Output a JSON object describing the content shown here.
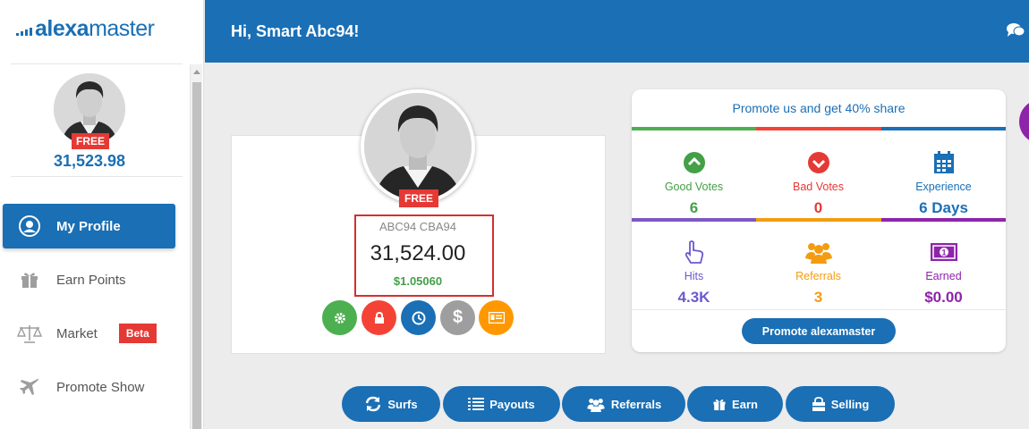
{
  "brand": {
    "part1": "alexa",
    "part2": "master"
  },
  "sidebar": {
    "badge": "FREE",
    "points": "31,523.98",
    "items": [
      {
        "label": "My Profile",
        "icon": "user-icon",
        "active": true
      },
      {
        "label": "Earn Points",
        "icon": "gift-icon"
      },
      {
        "label": "Market",
        "icon": "scale-icon",
        "badge": "Beta"
      },
      {
        "label": "Promote Show",
        "icon": "plane-icon"
      }
    ]
  },
  "header": {
    "title": "Hi, Smart Abc94!"
  },
  "profile": {
    "badge": "FREE",
    "name": "ABC94 CBA94",
    "points": "31,524.00",
    "money": "$1.05060",
    "actions": [
      {
        "name": "settings",
        "icon": "gear-icon",
        "color": "#4caf50"
      },
      {
        "name": "password",
        "icon": "lock-icon",
        "color": "#f44336"
      },
      {
        "name": "history",
        "icon": "clock-icon",
        "color": "#1a6fb5"
      },
      {
        "name": "payout",
        "icon": "dollar-icon",
        "color": "#9e9e9e"
      },
      {
        "name": "card",
        "icon": "id-card-icon",
        "color": "#ff9800"
      }
    ]
  },
  "stats": {
    "promo": "Promote us and get 40% share",
    "row1": [
      {
        "label": "Good Votes",
        "value": "6",
        "color": "#43a047",
        "icon": "chevron-up-circle-icon"
      },
      {
        "label": "Bad Votes",
        "value": "0",
        "color": "#e53935",
        "icon": "chevron-down-circle-icon"
      },
      {
        "label": "Experience",
        "value": "6 Days",
        "color": "#1a6fb5",
        "icon": "calendar-icon"
      }
    ],
    "row2": [
      {
        "label": "Hits",
        "value": "4.3K",
        "color": "#6a5acd",
        "icon": "pointer-hand-icon"
      },
      {
        "label": "Referrals",
        "value": "3",
        "color": "#f39c12",
        "icon": "users-icon"
      },
      {
        "label": "Earned",
        "value": "$0.00",
        "color": "#8e24aa",
        "icon": "money-icon"
      }
    ],
    "button": "Promote alexamaster"
  },
  "bottom_buttons": [
    {
      "label": "Surfs",
      "icon": "refresh-icon"
    },
    {
      "label": "Payouts",
      "icon": "list-icon"
    },
    {
      "label": "Referrals",
      "icon": "users-icon"
    },
    {
      "label": "Earn",
      "icon": "gift-icon"
    },
    {
      "label": "Selling",
      "icon": "shopping-bag-icon"
    }
  ],
  "colors": {
    "primary": "#1a6fb5",
    "red": "#e53935",
    "green": "#43a047",
    "orange": "#f39c12",
    "purple": "#8e24aa"
  }
}
